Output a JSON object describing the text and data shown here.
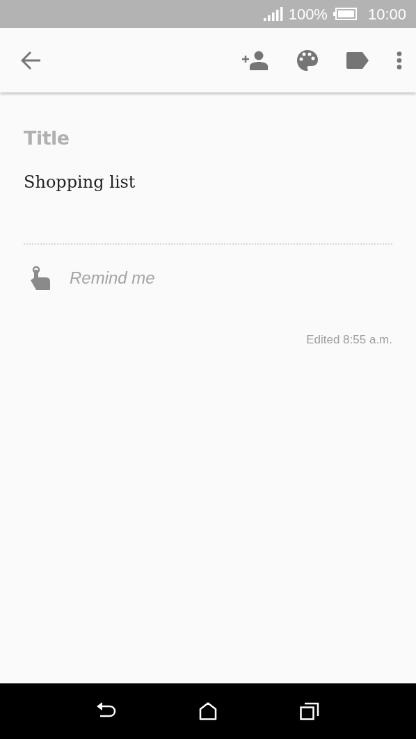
{
  "status_bar": {
    "battery": "100%",
    "time": "10:00"
  },
  "note": {
    "title": {
      "placeholder": "Title"
    },
    "body": "Shopping list"
  },
  "reminder": {
    "placeholder": "Remind me"
  },
  "edited": "Edited 8:55 a.m."
}
